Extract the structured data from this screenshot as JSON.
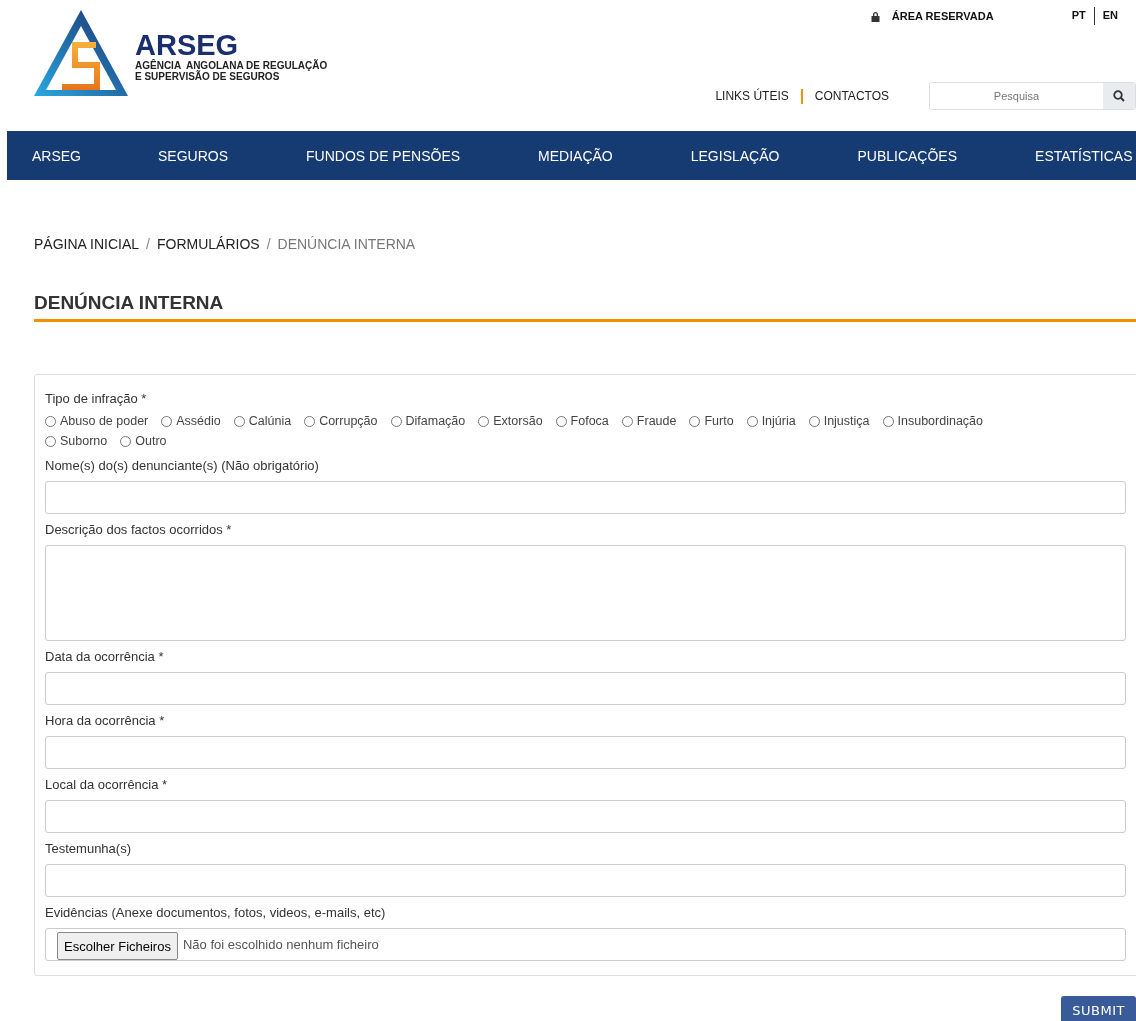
{
  "header": {
    "logo": {
      "name": "ARSEG",
      "tagline_1": "AGÊNCIA  ANGOLANA DE REGULAÇÃO",
      "tagline_2": "E SUPERVISÃO DE SEGUROS"
    },
    "reserved_area": "ÁREA RESERVADA",
    "languages": [
      "PT",
      "EN"
    ],
    "links": [
      "LINKS ÚTEIS",
      "CONTACTOS"
    ],
    "search": {
      "placeholder": "Pesquisa"
    }
  },
  "nav": [
    "ARSEG",
    "SEGUROS",
    "FUNDOS DE PENSÕES",
    "MEDIAÇÃO",
    "LEGISLAÇÃO",
    "PUBLICAÇÕES",
    "ESTATÍSTICAS"
  ],
  "breadcrumb_separator": "/",
  "breadcrumb": [
    {
      "label": "PÁGINA INICIAL",
      "current": false
    },
    {
      "label": "FORMULÁRIOS",
      "current": false
    },
    {
      "label": "DENÚNCIA INTERNA",
      "current": true
    }
  ],
  "title": "DENÚNCIA INTERNA",
  "form": {
    "infraction": {
      "label": "Tipo de infração *",
      "options": [
        {
          "label": "Abuso de poder",
          "selected": false
        },
        {
          "label": "Assédio",
          "selected": false
        },
        {
          "label": "Calúnia",
          "selected": false
        },
        {
          "label": "Corrupção",
          "selected": false
        },
        {
          "label": "Difamação",
          "selected": false
        },
        {
          "label": "Extorsão",
          "selected": false
        },
        {
          "label": "Fofoca",
          "selected": false
        },
        {
          "label": "Fraude",
          "selected": false
        },
        {
          "label": "Furto",
          "selected": false
        },
        {
          "label": "Injúria",
          "selected": false
        },
        {
          "label": "Injustiça",
          "selected": false
        },
        {
          "label": "Insubordinação",
          "selected": false
        },
        {
          "label": "Suborno",
          "selected": false
        },
        {
          "label": "Outro",
          "selected": false
        }
      ]
    },
    "fields": [
      {
        "kind": "text",
        "label": "Nome(s) do(s) denunciante(s) (Não obrigatório)"
      },
      {
        "kind": "textarea",
        "label": "Descrição dos factos ocorridos *"
      },
      {
        "kind": "text",
        "label": "Data da ocorrência *"
      },
      {
        "kind": "text",
        "label": "Hora da ocorrência *"
      },
      {
        "kind": "text",
        "label": "Local da ocorrência *"
      },
      {
        "kind": "text",
        "label": "Testemunha(s)"
      },
      {
        "kind": "file",
        "label": "Evidências (Anexe documentos, fotos, videos, e-mails, etc)",
        "button": "Escolher Ficheiros",
        "status": "Não foi escolhido nenhum ficheiro"
      }
    ]
  },
  "submit": "SUBMIT"
}
